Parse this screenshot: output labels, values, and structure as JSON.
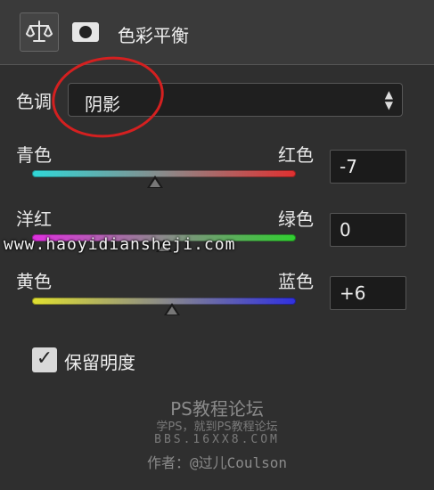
{
  "panel": {
    "title": "色彩平衡",
    "icons": [
      "balance-icon",
      "mask-icon"
    ]
  },
  "tone": {
    "label": "色调",
    "value": "阴影"
  },
  "sliders": [
    {
      "left_label": "青色",
      "right_label": "红色",
      "value": "-7",
      "level": -7
    },
    {
      "left_label": "洋红",
      "right_label": "绿色",
      "value": "0",
      "level": 0
    },
    {
      "left_label": "黄色",
      "right_label": "蓝色",
      "value": "+6",
      "level": 6
    }
  ],
  "slider_range": [
    -100,
    100
  ],
  "preserve": {
    "label": "保留明度",
    "checked": true,
    "check_glyph": "✓"
  },
  "watermarks": {
    "url": "www.haoyidiansheji.com",
    "forum": "PS教程论坛",
    "slogan": "学PS，就到PS教程论坛",
    "site": "BBS.16XX8.COM",
    "author": "作者：@过儿Coulson"
  },
  "colors": {
    "annotation_circle": "#d42020",
    "panel_bg": "#2f2f2f"
  }
}
